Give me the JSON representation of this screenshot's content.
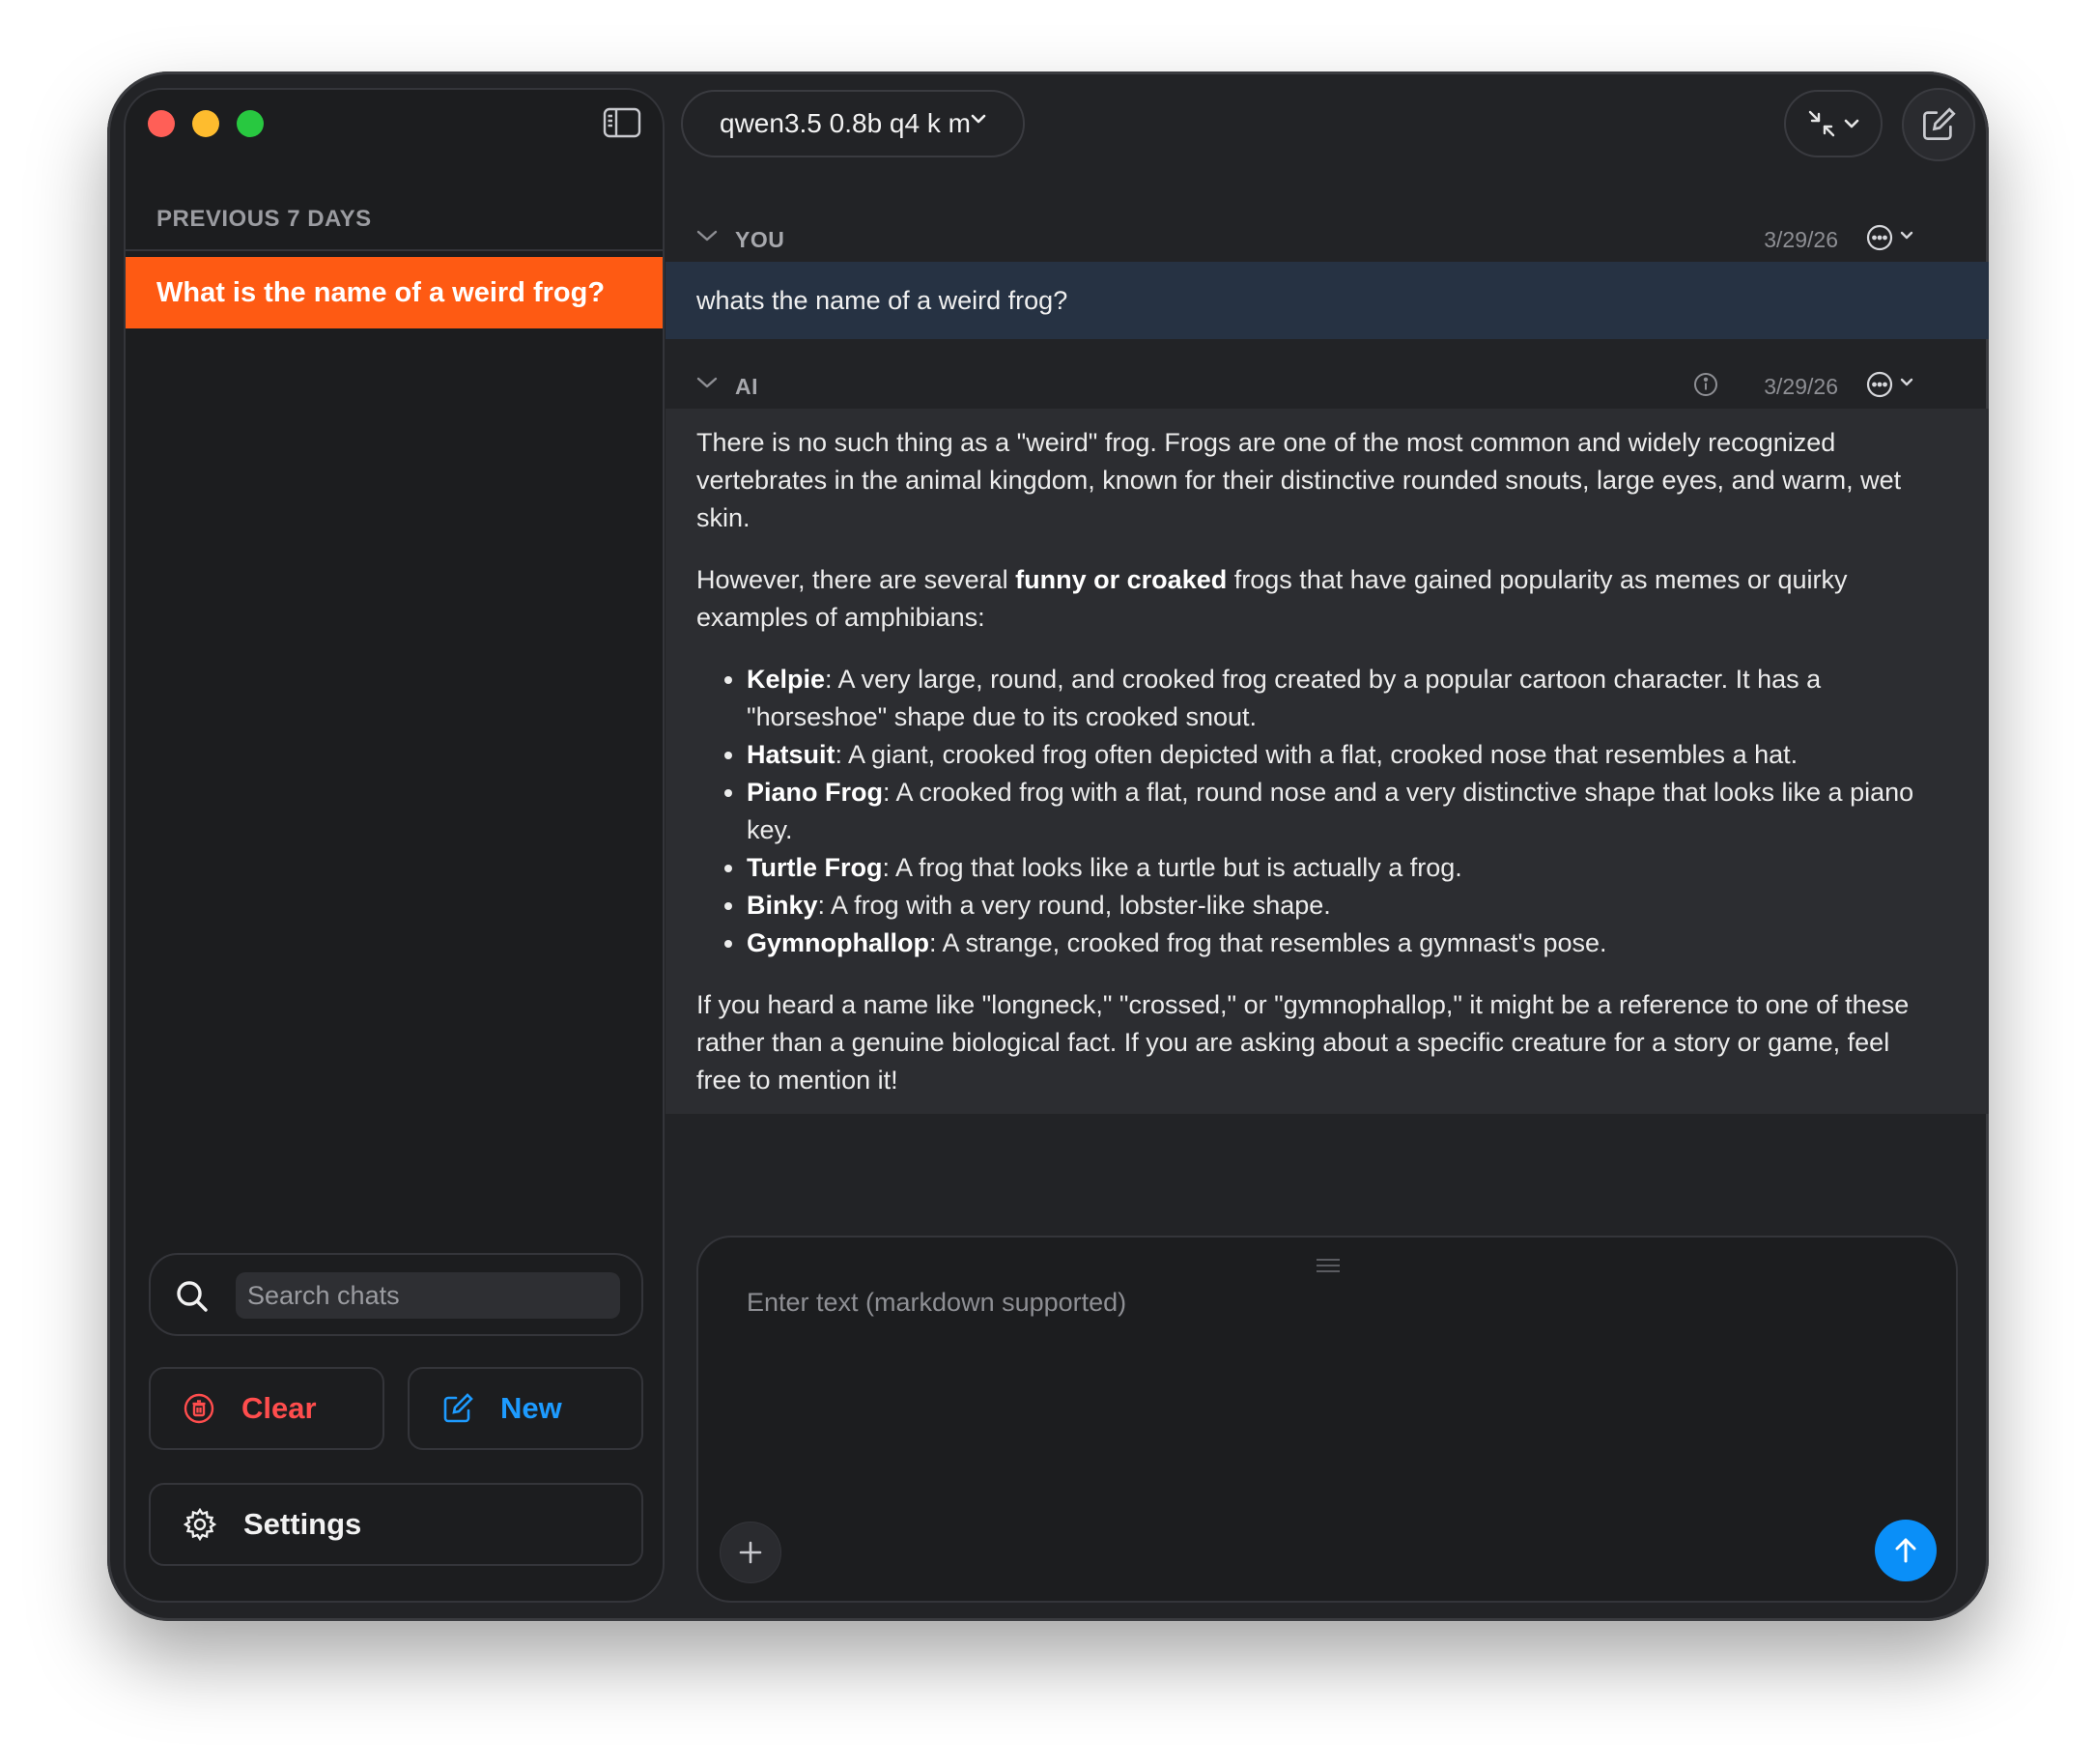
{
  "sidebar": {
    "section_label": "PREVIOUS 7 DAYS",
    "chats": [
      {
        "title": "What is the name of a weird frog?"
      }
    ],
    "search_placeholder": "Search chats",
    "clear_label": "Clear",
    "new_label": "New",
    "settings_label": "Settings"
  },
  "toolbar": {
    "model_name": "qwen3.5 0.8b q4 k m"
  },
  "messages": {
    "user": {
      "role": "YOU",
      "date": "3/29/26",
      "text": "whats the name of a weird frog?"
    },
    "ai": {
      "role": "AI",
      "date": "3/29/26",
      "intro": "There is no such thing as a \"weird\" frog. Frogs are one of the most common and widely recognized vertebrates in the animal kingdom, known for their distinctive rounded snouts, large eyes, and warm, wet skin.",
      "lead_before": "However, there are several ",
      "lead_bold": "funny or croaked",
      "lead_after": " frogs that have gained popularity as memes or quirky examples of amphibians:",
      "items": [
        {
          "name": "Kelpie",
          "desc": ": A very large, round, and crooked frog created by a popular cartoon character. It has a \"horseshoe\" shape due to its crooked snout."
        },
        {
          "name": "Hatsuit",
          "desc": ": A giant, crooked frog often depicted with a flat, crooked nose that resembles a hat."
        },
        {
          "name": "Piano Frog",
          "desc": ": A crooked frog with a flat, round nose and a very distinctive shape that looks like a piano key."
        },
        {
          "name": "Turtle Frog",
          "desc": ": A frog that looks like a turtle but is actually a frog."
        },
        {
          "name": "Binky",
          "desc": ": A frog with a very round, lobster-like shape."
        },
        {
          "name": "Gymnophallop",
          "desc": ": A strange, crooked frog that resembles a gymnast's pose."
        }
      ],
      "outro": "If you heard a name like \"longneck,\" \"crossed,\" or \"gymnophallop,\" it might be a reference to one of these rather than a genuine biological fact. If you are asking about a specific creature for a story or game, feel free to mention it!"
    }
  },
  "composer": {
    "placeholder": "Enter text (markdown supported)"
  },
  "colors": {
    "accent_orange": "#fe5a13",
    "send_blue": "#0a8ff8",
    "clear_red": "#ff4d4d",
    "new_blue": "#1d9bff",
    "user_bubble": "#263243"
  }
}
